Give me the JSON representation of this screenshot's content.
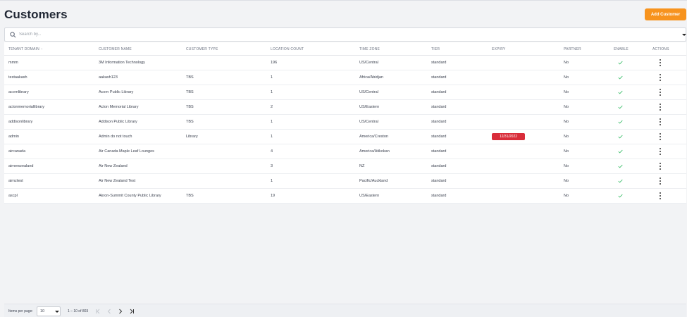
{
  "page": {
    "title": "Customers"
  },
  "toolbar": {
    "add_label": "Add Customer"
  },
  "search": {
    "placeholder": "Search by..."
  },
  "colors": {
    "accent": "#f7931e",
    "danger": "#d92d3a",
    "check": "#3cbf6a"
  },
  "table": {
    "headers": {
      "tenant_domain": "TENANT DOMAIN",
      "customer_name": "CUSTOMER NAME",
      "customer_type": "CUSTOMER TYPE",
      "location_count": "LOCATION COUNT",
      "time_zone": "TIME ZONE",
      "tier": "TIER",
      "expiry": "EXPIRY",
      "partner": "PARTNER",
      "enable": "ENABLE",
      "actions": "ACTIONS"
    },
    "sort_icon": "↑",
    "rows": [
      {
        "domain": "mmm",
        "name": "3M Information Technology",
        "type": "",
        "count": "196",
        "tz": "US/Central",
        "tier": "standard",
        "expiry": "",
        "partner": "No",
        "enabled": true
      },
      {
        "domain": "testaakash",
        "name": "aakash123",
        "type": "TBS",
        "count": "1",
        "tz": "Africa/Abidjan",
        "tier": "standard",
        "expiry": "",
        "partner": "No",
        "enabled": true
      },
      {
        "domain": "acornlibrary",
        "name": "Acorn Public Library",
        "type": "TBS",
        "count": "1",
        "tz": "US/Central",
        "tier": "standard",
        "expiry": "",
        "partner": "No",
        "enabled": true
      },
      {
        "domain": "actonmemoriallibrary",
        "name": "Acton Memorial Library",
        "type": "TBS",
        "count": "2",
        "tz": "US/Eastern",
        "tier": "standard",
        "expiry": "",
        "partner": "No",
        "enabled": true
      },
      {
        "domain": "addisonlibrary",
        "name": "Addison Public Library",
        "type": "TBS",
        "count": "1",
        "tz": "US/Central",
        "tier": "standard",
        "expiry": "",
        "partner": "No",
        "enabled": true
      },
      {
        "domain": "admin",
        "name": "Admin do not touch",
        "type": "Library",
        "count": "1",
        "tz": "America/Creston",
        "tier": "standard",
        "expiry": "12/31/2022",
        "partner": "No",
        "enabled": true
      },
      {
        "domain": "aircanada",
        "name": "Air Canada Maple Leaf Lounges",
        "type": "",
        "count": "4",
        "tz": "America/Atikokan",
        "tier": "standard",
        "expiry": "",
        "partner": "No",
        "enabled": true
      },
      {
        "domain": "airnewzealand",
        "name": "Air New Zealand",
        "type": "",
        "count": "3",
        "tz": "NZ",
        "tier": "standard",
        "expiry": "",
        "partner": "No",
        "enabled": true
      },
      {
        "domain": "airnztest",
        "name": "Air New Zealand Test",
        "type": "",
        "count": "1",
        "tz": "Pacific/Auckland",
        "tier": "standard",
        "expiry": "",
        "partner": "No",
        "enabled": true
      },
      {
        "domain": "ascpl",
        "name": "Akron-Summit County Public Library",
        "type": "TBS",
        "count": "19",
        "tz": "US/Eastern",
        "tier": "standard",
        "expiry": "",
        "partner": "No",
        "enabled": true
      }
    ]
  },
  "pagination": {
    "items_per_page_label": "Items per page:",
    "items_per_page_value": "10",
    "range_label": "1 – 10 of 803",
    "icons": [
      "first-page-icon",
      "previous-page-icon",
      "next-page-icon",
      "last-page-icon"
    ]
  }
}
